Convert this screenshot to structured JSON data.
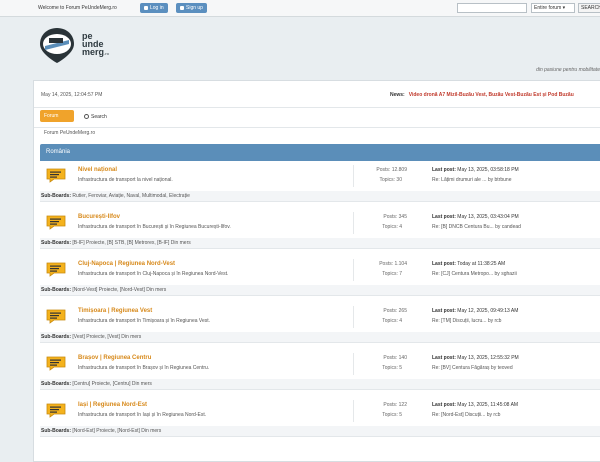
{
  "topbar": {
    "welcome": "Welcome to Forum PeUndeMerg.ro",
    "login_label": "Log in",
    "signup_label": "Sign up",
    "search_scope": "Entire forum",
    "search_button": "SEARCH"
  },
  "header": {
    "logo_line1": "pe",
    "logo_line2": "unde",
    "logo_line3": "merg",
    "logo_suffix": ".ro",
    "tagline": "din pasiune pentru mobilitate"
  },
  "datebar": {
    "date": "May 14, 2025, 12:04:57 PM",
    "news_label": "News:",
    "news_text": "Video dronă A7 Mizil-Buzău Vest, Buzău Vest-Buzău Est și Pod Buzău"
  },
  "tabs": {
    "forum": "Forum",
    "search": "Search"
  },
  "breadcrumb": "Forum PeUndeMerg.ro",
  "category": "România",
  "colors": {
    "accent": "#5b8eb9",
    "forum_title": "#d7891a",
    "news": "#c0392b",
    "tab": "#f0a32b"
  },
  "boards": [
    {
      "title": "Nivel național",
      "desc": "Infrastructura de transport la nivel național.",
      "posts": "Posts: 12.809",
      "topics": "Topics: 30",
      "lastpost_label": "Last post:",
      "lastpost_date": "May 13, 2025, 03:58:18 PM",
      "lastpost_re": "Re: Lățimi drumuri ale ... by btrbune",
      "sub_label": "Sub-Boards:",
      "sub": "Rutier, Feroviar, Aviație, Naval, Multimodal, Electrație"
    },
    {
      "title": "București-Ilfov",
      "desc": "Infrastructura de transport în București și în Regiunea București-Ilfov.",
      "posts": "Posts: 345",
      "topics": "Topics: 4",
      "lastpost_label": "Last post:",
      "lastpost_date": "May 13, 2025, 03:43:04 PM",
      "lastpost_re": "Re: [B] DNCB Centura Bu... by candead",
      "sub_label": "Sub-Boards:",
      "sub": "[B-IF] Proiecte, [B] STB, [B] Metrorex, [B-IF] Din mers"
    },
    {
      "title": "Cluj-Napoca | Regiunea Nord-Vest",
      "desc": "Infrastructura de transport în Cluj-Napoca și în Regiunea Nord-Vest.",
      "posts": "Posts: 1.104",
      "topics": "Topics: 7",
      "lastpost_label": "Last post:",
      "lastpost_date": "Today at 11:38:25 AM",
      "lastpost_re": "Re: [CJ] Centura Metropo... by sghazii",
      "sub_label": "Sub-Boards:",
      "sub": "[Nord-Vest] Proiecte, [Nord-Vest] Din mers"
    },
    {
      "title": "Timișoara | Regiunea Vest",
      "desc": "Infrastructura de transport în Timișoara și în Regiunea Vest.",
      "posts": "Posts: 265",
      "topics": "Topics: 4",
      "lastpost_label": "Last post:",
      "lastpost_date": "May 12, 2025, 09:49:13 AM",
      "lastpost_re": "Re: [TM] Discuții, lucru... by rcb",
      "sub_label": "Sub-Boards:",
      "sub": "[Vest] Proiecte, [Vest] Din mers"
    },
    {
      "title": "Brașov | Regiunea Centru",
      "desc": "Infrastructura de transport în Brașov și în Regiunea Centru.",
      "posts": "Posts: 140",
      "topics": "Topics: 5",
      "lastpost_label": "Last post:",
      "lastpost_date": "May 13, 2025, 12:55:32 PM",
      "lastpost_re": "Re: [BV] Centura Făgăraș by teoved",
      "sub_label": "Sub-Boards:",
      "sub": "[Centru] Proiecte, [Centru] Din mers"
    },
    {
      "title": "Iași | Regiunea Nord-Est",
      "desc": "Infrastructura de transport în Iași și în Regiunea Nord-Est.",
      "posts": "Posts: 122",
      "topics": "Topics: 5",
      "lastpost_label": "Last post:",
      "lastpost_date": "May 13, 2025, 11:45:08 AM",
      "lastpost_re": "Re: [Nord-Est] Discuții... by rcb",
      "sub_label": "Sub-Boards:",
      "sub": "[Nord-Est] Proiecte, [Nord-Est] Din mers"
    }
  ]
}
